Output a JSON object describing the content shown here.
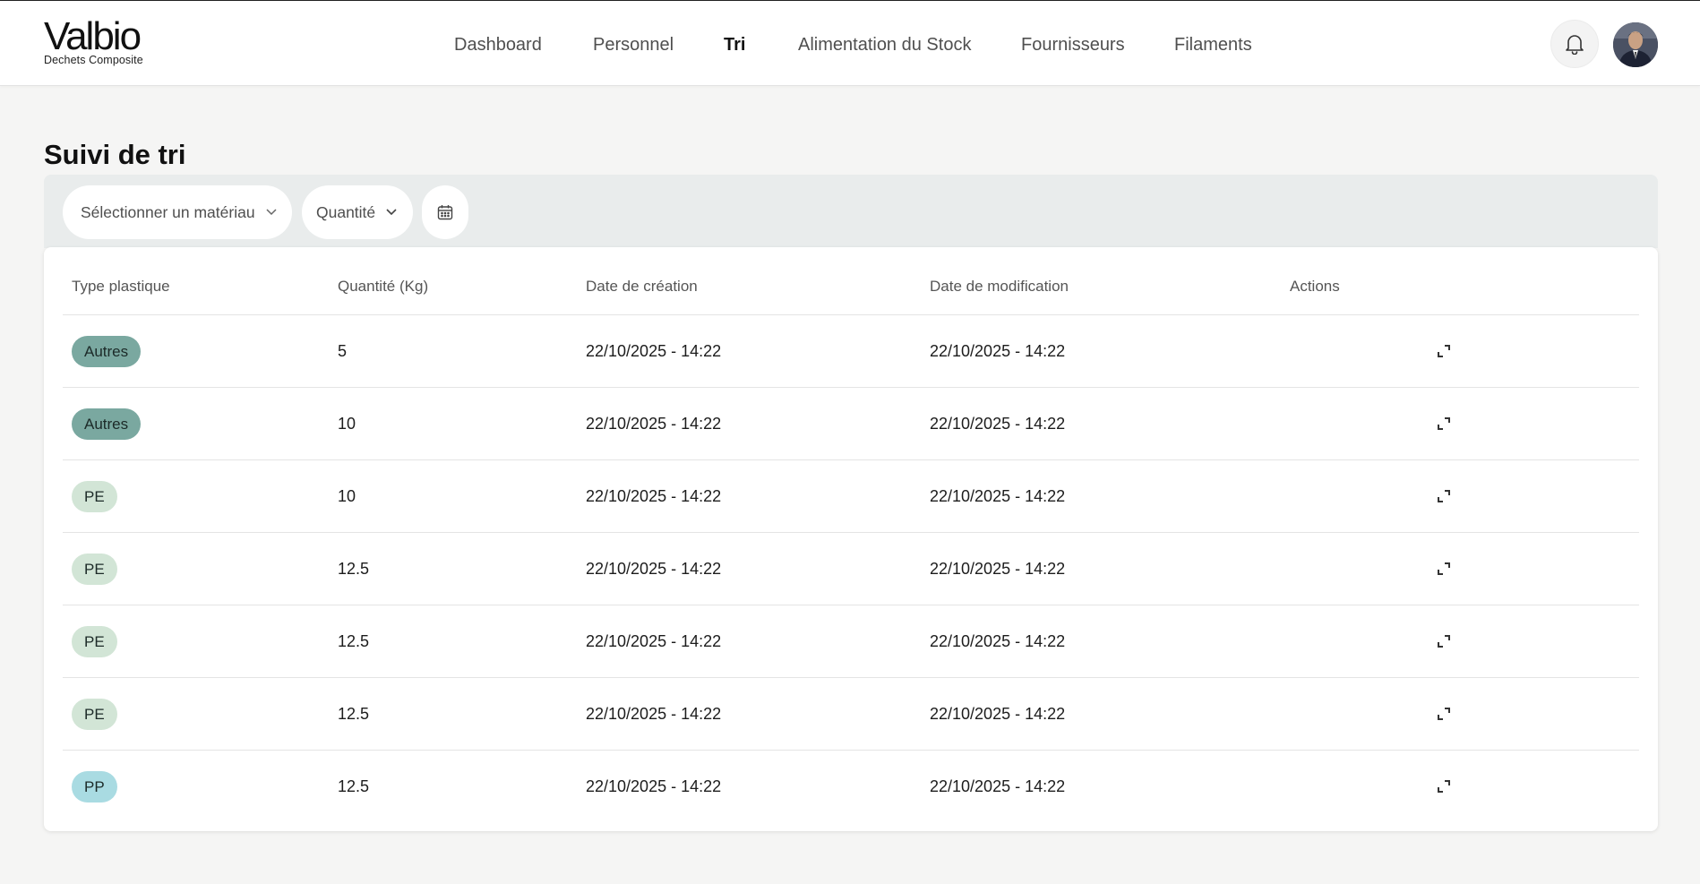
{
  "brand": {
    "name": "Valbio",
    "subtitle": "Dechets Composite"
  },
  "nav": [
    {
      "label": "Dashboard",
      "active": false
    },
    {
      "label": "Personnel",
      "active": false
    },
    {
      "label": "Tri",
      "active": true
    },
    {
      "label": "Alimentation du Stock",
      "active": false
    },
    {
      "label": "Fournisseurs",
      "active": false
    },
    {
      "label": "Filaments",
      "active": false
    }
  ],
  "header_icons": {
    "notifications": "bell-icon",
    "profile": "avatar"
  },
  "page": {
    "title": "Suivi de tri"
  },
  "filters": {
    "material_placeholder": "Sélectionner un matériau",
    "quantity_label": "Quantité",
    "date_icon": "calendar-icon"
  },
  "table": {
    "columns": [
      "Type plastique",
      "Quantité (Kg)",
      "Date de création",
      "Date de modification",
      "Actions"
    ],
    "rows": [
      {
        "type": "Autres",
        "quantity": "5",
        "created": "22/10/2025 - 14:22",
        "modified": "22/10/2025 - 14:22"
      },
      {
        "type": "Autres",
        "quantity": "10",
        "created": "22/10/2025 - 14:22",
        "modified": "22/10/2025 - 14:22"
      },
      {
        "type": "PE",
        "quantity": "10",
        "created": "22/10/2025 - 14:22",
        "modified": "22/10/2025 - 14:22"
      },
      {
        "type": "PE",
        "quantity": "12.5",
        "created": "22/10/2025 - 14:22",
        "modified": "22/10/2025 - 14:22"
      },
      {
        "type": "PE",
        "quantity": "12.5",
        "created": "22/10/2025 - 14:22",
        "modified": "22/10/2025 - 14:22"
      },
      {
        "type": "PE",
        "quantity": "12.5",
        "created": "22/10/2025 - 14:22",
        "modified": "22/10/2025 - 14:22"
      },
      {
        "type": "PP",
        "quantity": "12.5",
        "created": "22/10/2025 - 14:22",
        "modified": "22/10/2025 - 14:22"
      }
    ],
    "action_icon": "expand-icon"
  },
  "badge_colors": {
    "Autres": "#7aa8a0",
    "PE": "#d2e5d6",
    "PP": "#a9dbe2"
  }
}
